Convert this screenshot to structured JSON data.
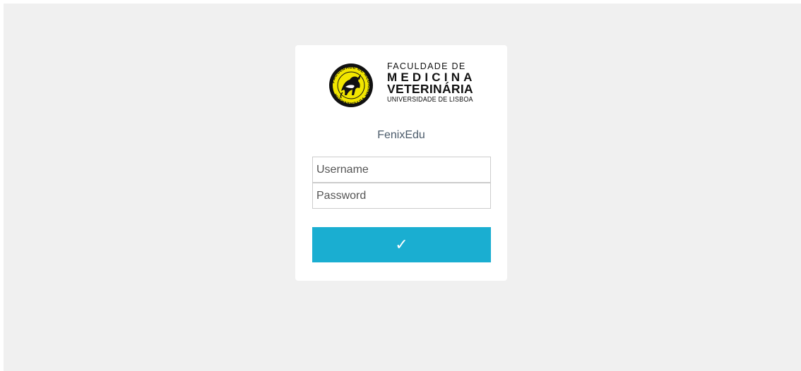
{
  "logo": {
    "line1": "FACULDADE DE",
    "line2": "MEDICINA",
    "line3": "VETERINÁRIA",
    "line4": "UNIVERSIDADE DE LISBOA",
    "emblem_text": "FACULDADE DE MEDICINA VETERINÁRIA",
    "emblem_colors": {
      "ring": "#f2e600",
      "dark": "#111111"
    }
  },
  "app_title": "FenixEdu",
  "form": {
    "username_placeholder": "Username",
    "password_placeholder": "Password",
    "submit_label": "✓"
  },
  "colors": {
    "background": "#f0f0f0",
    "card": "#ffffff",
    "accent": "#1aaed1",
    "title": "#4a5a6a"
  }
}
